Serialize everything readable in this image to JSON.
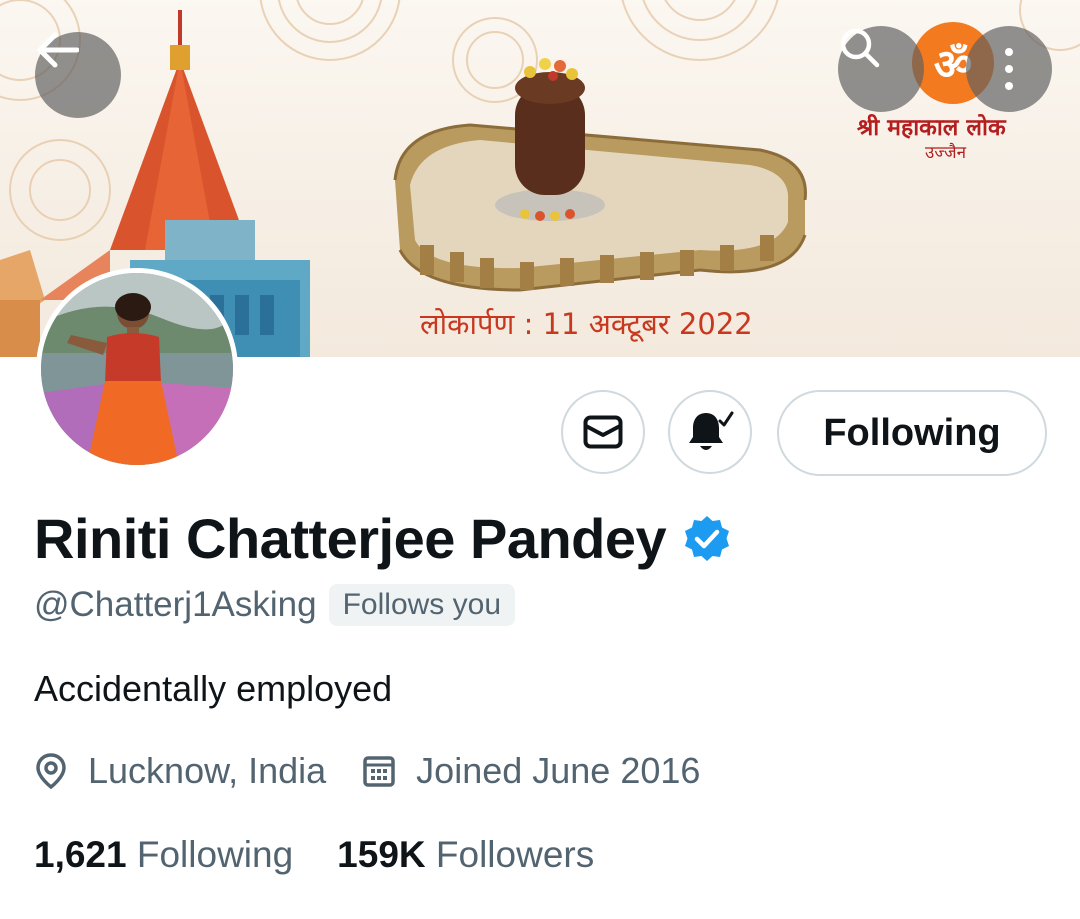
{
  "banner": {
    "brand_name": "श्री महाकाल लोक",
    "brand_city": "उज्जैन",
    "date_text": "लोकार्पण : 11 अक्टूबर 2022"
  },
  "header_icons": {
    "back": "arrow-left-icon",
    "search": "search-icon",
    "more": "more-vertical-icon"
  },
  "actions": {
    "message_icon": "envelope-icon",
    "notify_icon": "bell-check-icon",
    "following_label": "Following"
  },
  "profile": {
    "name": "Riniti Chatterjee Pandey",
    "verified": true,
    "handle": "@Chatterj1Asking",
    "follows_you": "Follows you",
    "bio": "Accidentally employed",
    "location": "Lucknow, India",
    "joined": "Joined June 2016",
    "following_count": "1,621",
    "following_label": "Following",
    "followers_count": "159K",
    "followers_label": "Followers"
  },
  "colors": {
    "verified_blue": "#1d9bf0",
    "secondary_text": "#536471",
    "brand_orange": "#f47a20",
    "banner_text_red": "#c8381f"
  }
}
